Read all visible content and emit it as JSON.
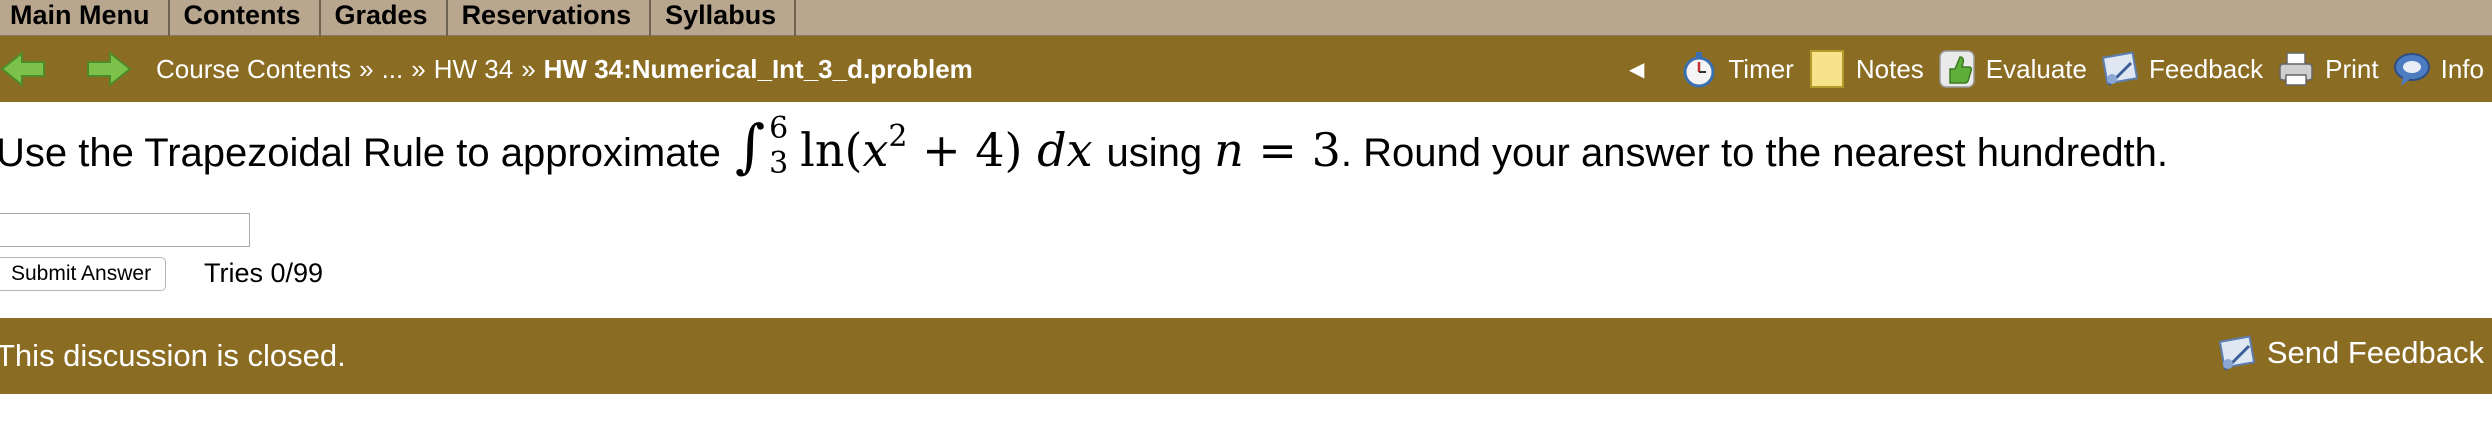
{
  "menu": {
    "items": [
      "Main Menu",
      "Contents",
      "Grades",
      "Reservations",
      "Syllabus"
    ]
  },
  "nav": {
    "breadcrumb": {
      "course_contents": "Course Contents",
      "sep": "»",
      "ellipsis": "...",
      "hw": "HW 34",
      "current": "HW 34:Numerical_Int_3_d.problem"
    },
    "collapse_glyph": "◀",
    "tools": {
      "timer": "Timer",
      "notes": "Notes",
      "evaluate": "Evaluate",
      "feedback": "Feedback",
      "print": "Print",
      "info": "Info"
    }
  },
  "question": {
    "prefix": "Use the Trapezoidal Rule to approximate",
    "integral_upper": "6",
    "integral_lower": "3",
    "integrand_fn": "ln",
    "integrand_var": "x",
    "integrand_exp": "2",
    "integrand_rest": " + 4)",
    "dx": "dx",
    "middle": "using",
    "n_var": "n",
    "n_eq": " = 3",
    "suffix": ". Round your answer to the nearest hundredth."
  },
  "answer": {
    "value": "",
    "submit_label": "Submit Answer",
    "tries": "Tries 0/99"
  },
  "discussion": {
    "text": "This discussion is closed.",
    "send_feedback": "Send Feedback"
  },
  "colors": {
    "menu_bg": "#b8a68f",
    "nav_bg": "#8b6c23",
    "arrow_green": "#7cc24a"
  }
}
